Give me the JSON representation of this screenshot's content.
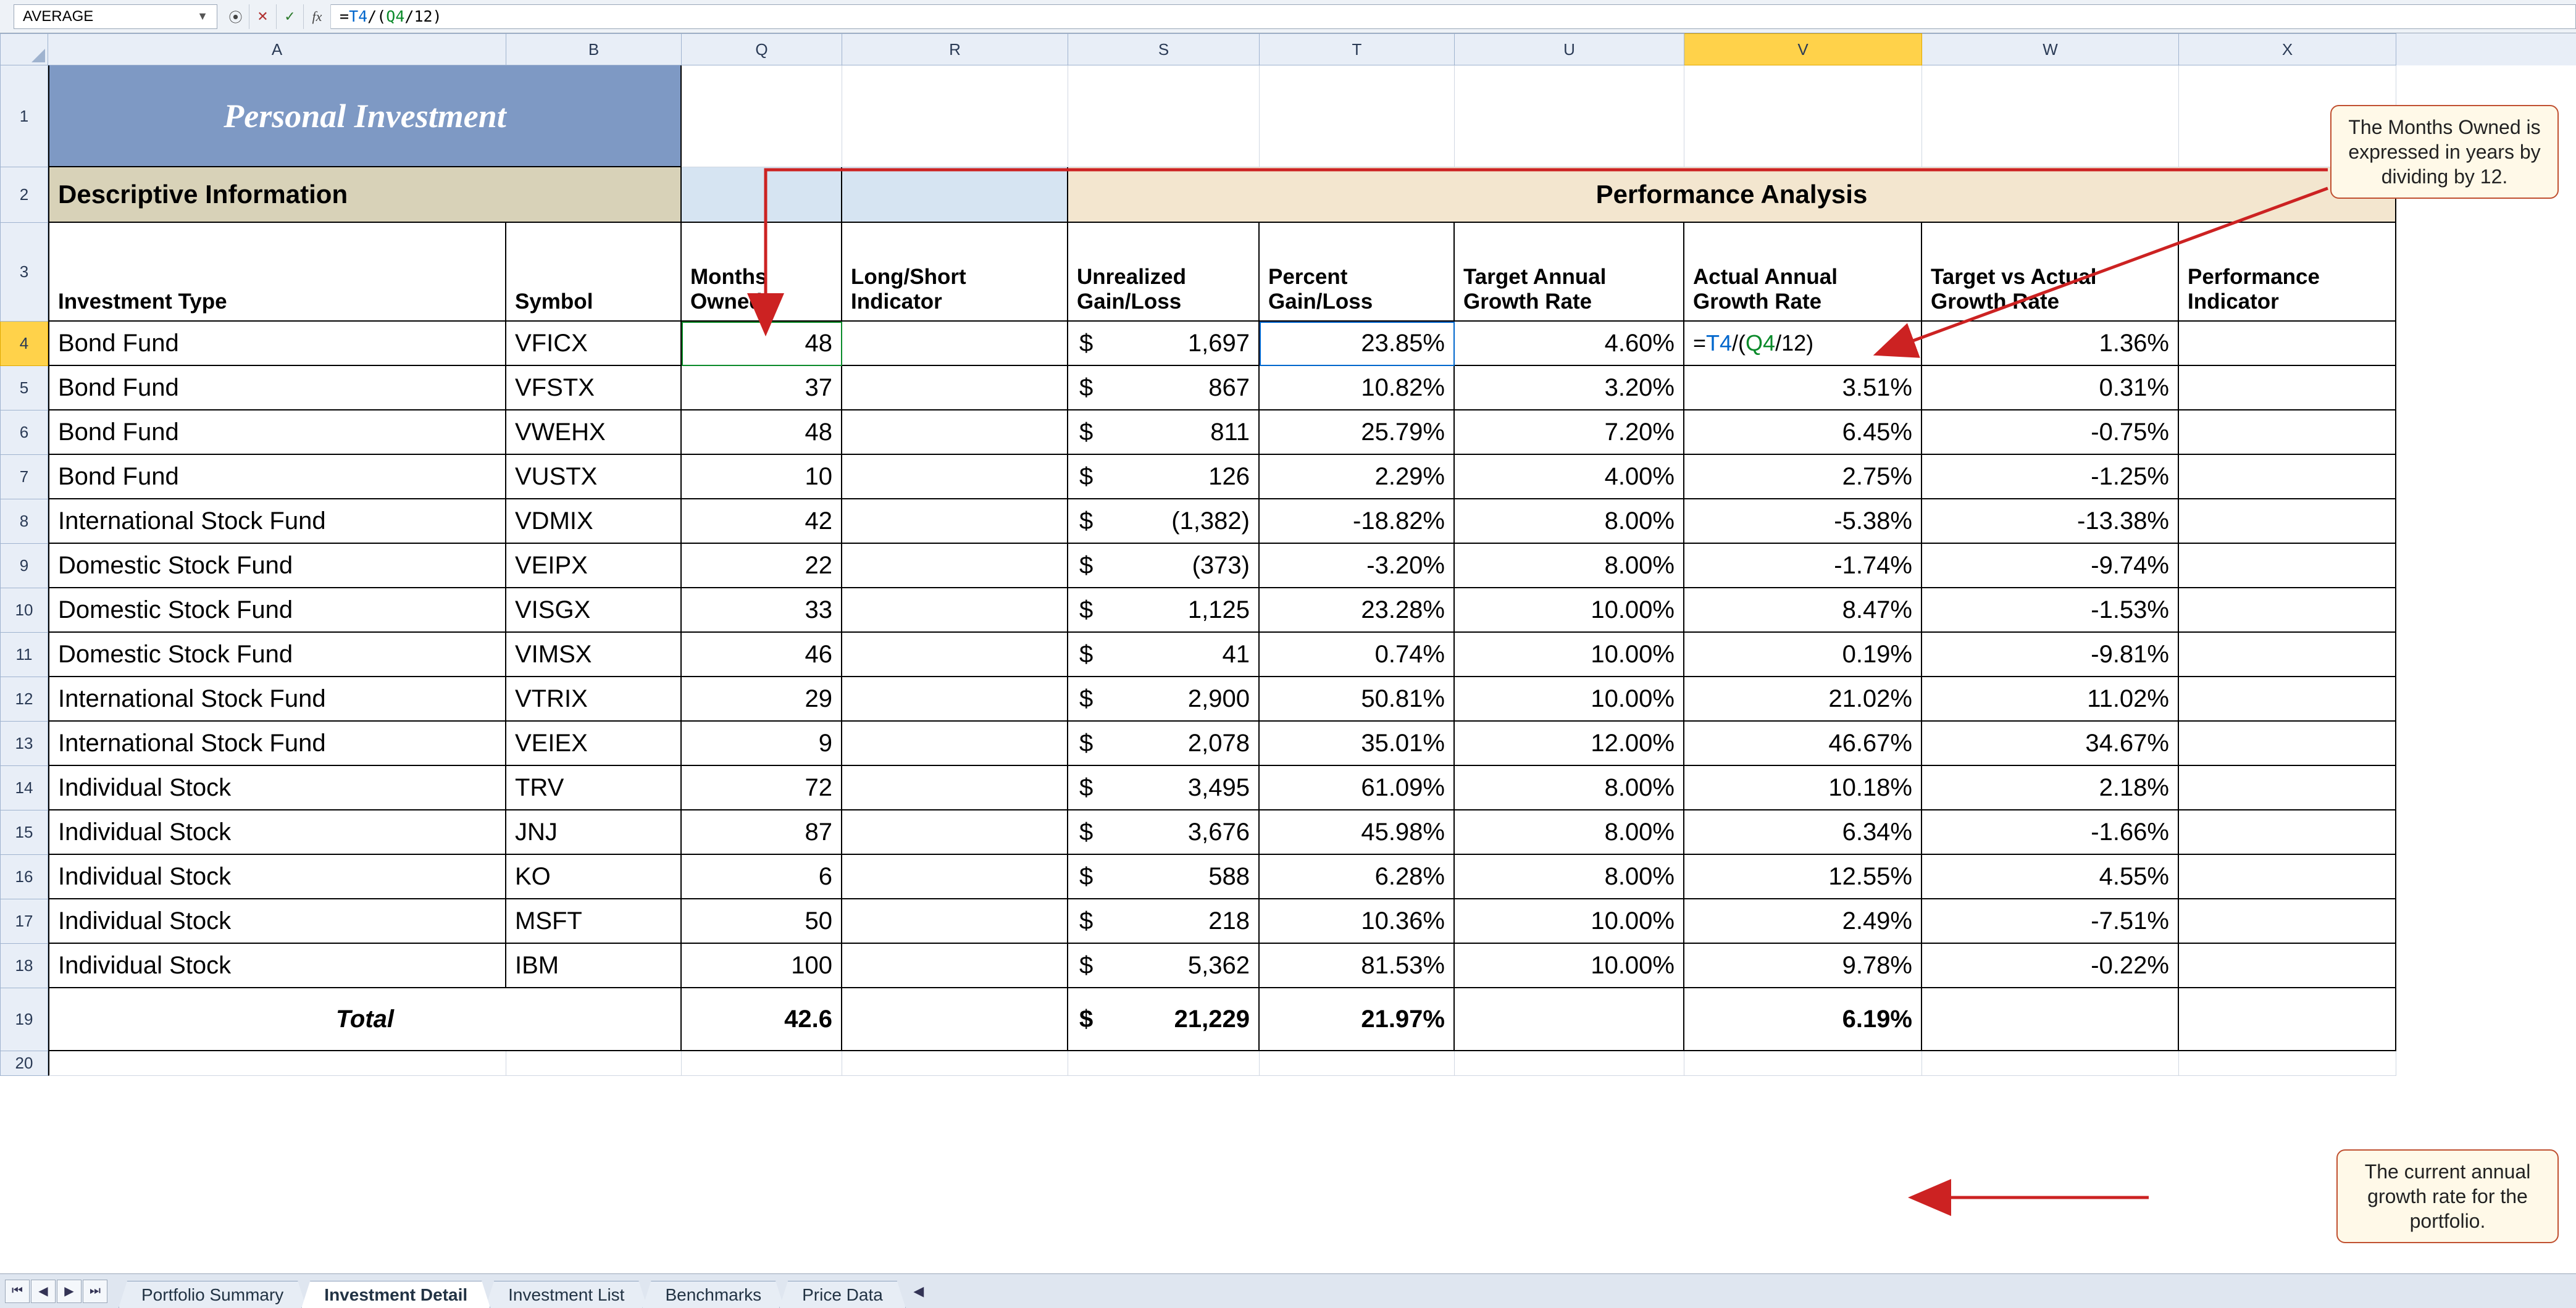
{
  "colors": {
    "accent": "#7e99c4",
    "callout_border": "#c05030",
    "callout_bg": "#fff9e8"
  },
  "nameBox": "AVERAGE",
  "formula": "=T4/(Q4/12)",
  "formula_parts": {
    "eq": "=",
    "r1": "T4",
    "op1": "/(",
    "r2": "Q4",
    "op2": "/12)"
  },
  "columns": [
    "A",
    "B",
    "Q",
    "R",
    "S",
    "T",
    "U",
    "V",
    "W",
    "X"
  ],
  "rows": [
    "1",
    "2",
    "3",
    "4",
    "5",
    "6",
    "7",
    "8",
    "9",
    "10",
    "11",
    "12",
    "13",
    "14",
    "15",
    "16",
    "17",
    "18",
    "19",
    "20"
  ],
  "activeRow": "4",
  "activeCol": "V",
  "title": "Personal Investment",
  "section_desc": "Descriptive Information",
  "section_perf": "Performance Analysis",
  "headers": {
    "A": "Investment Type",
    "B": "Symbol",
    "Q": "Months Owned",
    "R": "Long/Short Indicator",
    "S": "Unrealized Gain/Loss",
    "T": "Percent Gain/Loss",
    "U": "Target Annual Growth Rate",
    "V": "Actual Annual Growth Rate",
    "W": "Target vs Actual Growth Rate",
    "X": "Performance Indicator"
  },
  "data": [
    {
      "type": "Bond Fund",
      "sym": "VFICX",
      "months": "48",
      "ugl": "1,697",
      "pgl": "23.85%",
      "tgt": "4.60%",
      "act": "=T4/(Q4/12)",
      "tva": "1.36%"
    },
    {
      "type": "Bond Fund",
      "sym": "VFSTX",
      "months": "37",
      "ugl": "867",
      "pgl": "10.82%",
      "tgt": "3.20%",
      "act": "3.51%",
      "tva": "0.31%"
    },
    {
      "type": "Bond Fund",
      "sym": "VWEHX",
      "months": "48",
      "ugl": "811",
      "pgl": "25.79%",
      "tgt": "7.20%",
      "act": "6.45%",
      "tva": "-0.75%"
    },
    {
      "type": "Bond Fund",
      "sym": "VUSTX",
      "months": "10",
      "ugl": "126",
      "pgl": "2.29%",
      "tgt": "4.00%",
      "act": "2.75%",
      "tva": "-1.25%"
    },
    {
      "type": "International Stock Fund",
      "sym": "VDMIX",
      "months": "42",
      "ugl": "(1,382)",
      "pgl": "-18.82%",
      "tgt": "8.00%",
      "act": "-5.38%",
      "tva": "-13.38%"
    },
    {
      "type": "Domestic Stock Fund",
      "sym": "VEIPX",
      "months": "22",
      "ugl": "(373)",
      "pgl": "-3.20%",
      "tgt": "8.00%",
      "act": "-1.74%",
      "tva": "-9.74%"
    },
    {
      "type": "Domestic Stock Fund",
      "sym": "VISGX",
      "months": "33",
      "ugl": "1,125",
      "pgl": "23.28%",
      "tgt": "10.00%",
      "act": "8.47%",
      "tva": "-1.53%"
    },
    {
      "type": "Domestic Stock Fund",
      "sym": "VIMSX",
      "months": "46",
      "ugl": "41",
      "pgl": "0.74%",
      "tgt": "10.00%",
      "act": "0.19%",
      "tva": "-9.81%"
    },
    {
      "type": "International Stock Fund",
      "sym": "VTRIX",
      "months": "29",
      "ugl": "2,900",
      "pgl": "50.81%",
      "tgt": "10.00%",
      "act": "21.02%",
      "tva": "11.02%"
    },
    {
      "type": "International Stock Fund",
      "sym": "VEIEX",
      "months": "9",
      "ugl": "2,078",
      "pgl": "35.01%",
      "tgt": "12.00%",
      "act": "46.67%",
      "tva": "34.67%"
    },
    {
      "type": "Individual Stock",
      "sym": "TRV",
      "months": "72",
      "ugl": "3,495",
      "pgl": "61.09%",
      "tgt": "8.00%",
      "act": "10.18%",
      "tva": "2.18%"
    },
    {
      "type": "Individual Stock",
      "sym": "JNJ",
      "months": "87",
      "ugl": "3,676",
      "pgl": "45.98%",
      "tgt": "8.00%",
      "act": "6.34%",
      "tva": "-1.66%"
    },
    {
      "type": "Individual Stock",
      "sym": "KO",
      "months": "6",
      "ugl": "588",
      "pgl": "6.28%",
      "tgt": "8.00%",
      "act": "12.55%",
      "tva": "4.55%"
    },
    {
      "type": "Individual Stock",
      "sym": "MSFT",
      "months": "50",
      "ugl": "218",
      "pgl": "10.36%",
      "tgt": "10.00%",
      "act": "2.49%",
      "tva": "-7.51%"
    },
    {
      "type": "Individual Stock",
      "sym": "IBM",
      "months": "100",
      "ugl": "5,362",
      "pgl": "81.53%",
      "tgt": "10.00%",
      "act": "9.78%",
      "tva": "-0.22%"
    }
  ],
  "total": {
    "label": "Total",
    "months": "42.6",
    "ugl": "21,229",
    "pgl": "21.97%",
    "act": "6.19%"
  },
  "callout1": "The Months Owned is expressed in years by dividing by 12.",
  "callout2": "The current annual growth rate for the portfolio.",
  "tabs": [
    "Portfolio Summary",
    "Investment Detail",
    "Investment List",
    "Benchmarks",
    "Price Data"
  ],
  "activeTab": 1,
  "dollar": "$"
}
